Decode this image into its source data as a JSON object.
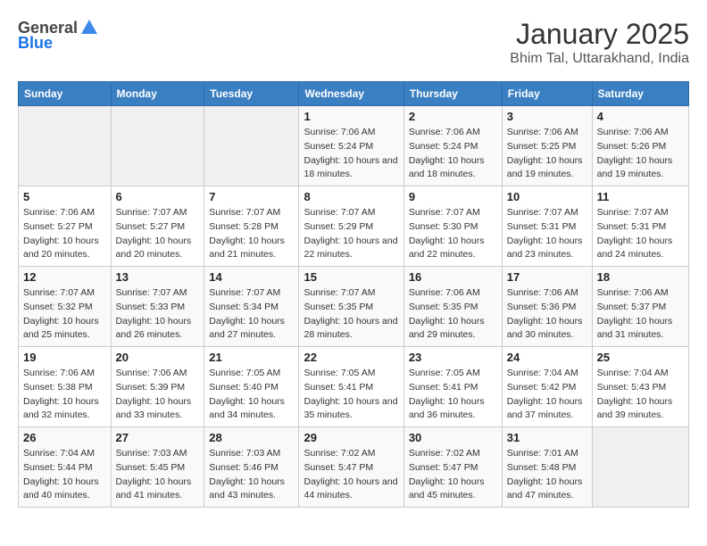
{
  "header": {
    "logo_general": "General",
    "logo_blue": "Blue",
    "title": "January 2025",
    "subtitle": "Bhim Tal, Uttarakhand, India"
  },
  "weekdays": [
    "Sunday",
    "Monday",
    "Tuesday",
    "Wednesday",
    "Thursday",
    "Friday",
    "Saturday"
  ],
  "weeks": [
    [
      {
        "day": "",
        "sunrise": "",
        "sunset": "",
        "daylight": "",
        "empty": true
      },
      {
        "day": "",
        "sunrise": "",
        "sunset": "",
        "daylight": "",
        "empty": true
      },
      {
        "day": "",
        "sunrise": "",
        "sunset": "",
        "daylight": "",
        "empty": true
      },
      {
        "day": "1",
        "sunrise": "Sunrise: 7:06 AM",
        "sunset": "Sunset: 5:24 PM",
        "daylight": "Daylight: 10 hours and 18 minutes.",
        "empty": false
      },
      {
        "day": "2",
        "sunrise": "Sunrise: 7:06 AM",
        "sunset": "Sunset: 5:24 PM",
        "daylight": "Daylight: 10 hours and 18 minutes.",
        "empty": false
      },
      {
        "day": "3",
        "sunrise": "Sunrise: 7:06 AM",
        "sunset": "Sunset: 5:25 PM",
        "daylight": "Daylight: 10 hours and 19 minutes.",
        "empty": false
      },
      {
        "day": "4",
        "sunrise": "Sunrise: 7:06 AM",
        "sunset": "Sunset: 5:26 PM",
        "daylight": "Daylight: 10 hours and 19 minutes.",
        "empty": false
      }
    ],
    [
      {
        "day": "5",
        "sunrise": "Sunrise: 7:06 AM",
        "sunset": "Sunset: 5:27 PM",
        "daylight": "Daylight: 10 hours and 20 minutes.",
        "empty": false
      },
      {
        "day": "6",
        "sunrise": "Sunrise: 7:07 AM",
        "sunset": "Sunset: 5:27 PM",
        "daylight": "Daylight: 10 hours and 20 minutes.",
        "empty": false
      },
      {
        "day": "7",
        "sunrise": "Sunrise: 7:07 AM",
        "sunset": "Sunset: 5:28 PM",
        "daylight": "Daylight: 10 hours and 21 minutes.",
        "empty": false
      },
      {
        "day": "8",
        "sunrise": "Sunrise: 7:07 AM",
        "sunset": "Sunset: 5:29 PM",
        "daylight": "Daylight: 10 hours and 22 minutes.",
        "empty": false
      },
      {
        "day": "9",
        "sunrise": "Sunrise: 7:07 AM",
        "sunset": "Sunset: 5:30 PM",
        "daylight": "Daylight: 10 hours and 22 minutes.",
        "empty": false
      },
      {
        "day": "10",
        "sunrise": "Sunrise: 7:07 AM",
        "sunset": "Sunset: 5:31 PM",
        "daylight": "Daylight: 10 hours and 23 minutes.",
        "empty": false
      },
      {
        "day": "11",
        "sunrise": "Sunrise: 7:07 AM",
        "sunset": "Sunset: 5:31 PM",
        "daylight": "Daylight: 10 hours and 24 minutes.",
        "empty": false
      }
    ],
    [
      {
        "day": "12",
        "sunrise": "Sunrise: 7:07 AM",
        "sunset": "Sunset: 5:32 PM",
        "daylight": "Daylight: 10 hours and 25 minutes.",
        "empty": false
      },
      {
        "day": "13",
        "sunrise": "Sunrise: 7:07 AM",
        "sunset": "Sunset: 5:33 PM",
        "daylight": "Daylight: 10 hours and 26 minutes.",
        "empty": false
      },
      {
        "day": "14",
        "sunrise": "Sunrise: 7:07 AM",
        "sunset": "Sunset: 5:34 PM",
        "daylight": "Daylight: 10 hours and 27 minutes.",
        "empty": false
      },
      {
        "day": "15",
        "sunrise": "Sunrise: 7:07 AM",
        "sunset": "Sunset: 5:35 PM",
        "daylight": "Daylight: 10 hours and 28 minutes.",
        "empty": false
      },
      {
        "day": "16",
        "sunrise": "Sunrise: 7:06 AM",
        "sunset": "Sunset: 5:35 PM",
        "daylight": "Daylight: 10 hours and 29 minutes.",
        "empty": false
      },
      {
        "day": "17",
        "sunrise": "Sunrise: 7:06 AM",
        "sunset": "Sunset: 5:36 PM",
        "daylight": "Daylight: 10 hours and 30 minutes.",
        "empty": false
      },
      {
        "day": "18",
        "sunrise": "Sunrise: 7:06 AM",
        "sunset": "Sunset: 5:37 PM",
        "daylight": "Daylight: 10 hours and 31 minutes.",
        "empty": false
      }
    ],
    [
      {
        "day": "19",
        "sunrise": "Sunrise: 7:06 AM",
        "sunset": "Sunset: 5:38 PM",
        "daylight": "Daylight: 10 hours and 32 minutes.",
        "empty": false
      },
      {
        "day": "20",
        "sunrise": "Sunrise: 7:06 AM",
        "sunset": "Sunset: 5:39 PM",
        "daylight": "Daylight: 10 hours and 33 minutes.",
        "empty": false
      },
      {
        "day": "21",
        "sunrise": "Sunrise: 7:05 AM",
        "sunset": "Sunset: 5:40 PM",
        "daylight": "Daylight: 10 hours and 34 minutes.",
        "empty": false
      },
      {
        "day": "22",
        "sunrise": "Sunrise: 7:05 AM",
        "sunset": "Sunset: 5:41 PM",
        "daylight": "Daylight: 10 hours and 35 minutes.",
        "empty": false
      },
      {
        "day": "23",
        "sunrise": "Sunrise: 7:05 AM",
        "sunset": "Sunset: 5:41 PM",
        "daylight": "Daylight: 10 hours and 36 minutes.",
        "empty": false
      },
      {
        "day": "24",
        "sunrise": "Sunrise: 7:04 AM",
        "sunset": "Sunset: 5:42 PM",
        "daylight": "Daylight: 10 hours and 37 minutes.",
        "empty": false
      },
      {
        "day": "25",
        "sunrise": "Sunrise: 7:04 AM",
        "sunset": "Sunset: 5:43 PM",
        "daylight": "Daylight: 10 hours and 39 minutes.",
        "empty": false
      }
    ],
    [
      {
        "day": "26",
        "sunrise": "Sunrise: 7:04 AM",
        "sunset": "Sunset: 5:44 PM",
        "daylight": "Daylight: 10 hours and 40 minutes.",
        "empty": false
      },
      {
        "day": "27",
        "sunrise": "Sunrise: 7:03 AM",
        "sunset": "Sunset: 5:45 PM",
        "daylight": "Daylight: 10 hours and 41 minutes.",
        "empty": false
      },
      {
        "day": "28",
        "sunrise": "Sunrise: 7:03 AM",
        "sunset": "Sunset: 5:46 PM",
        "daylight": "Daylight: 10 hours and 43 minutes.",
        "empty": false
      },
      {
        "day": "29",
        "sunrise": "Sunrise: 7:02 AM",
        "sunset": "Sunset: 5:47 PM",
        "daylight": "Daylight: 10 hours and 44 minutes.",
        "empty": false
      },
      {
        "day": "30",
        "sunrise": "Sunrise: 7:02 AM",
        "sunset": "Sunset: 5:47 PM",
        "daylight": "Daylight: 10 hours and 45 minutes.",
        "empty": false
      },
      {
        "day": "31",
        "sunrise": "Sunrise: 7:01 AM",
        "sunset": "Sunset: 5:48 PM",
        "daylight": "Daylight: 10 hours and 47 minutes.",
        "empty": false
      },
      {
        "day": "",
        "sunrise": "",
        "sunset": "",
        "daylight": "",
        "empty": true
      }
    ]
  ]
}
